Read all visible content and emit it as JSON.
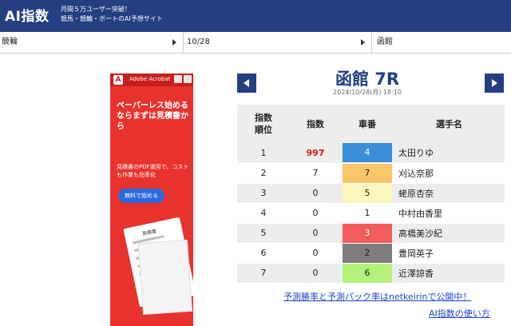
{
  "header": {
    "logo": "AI指数",
    "tagline_1": "月間５万ユーザー突破！",
    "tagline_2": "競馬・競輪・ボートのAI予想サイト"
  },
  "selectors": {
    "sport": "競輪",
    "date": "10/28",
    "venue": "函館"
  },
  "ad": {
    "brand": "Adobe Acrobat",
    "headline": "ペーパーレス始めるならまずは見積書から",
    "body": "見積書のPDF運用で、コストも作業も効率化",
    "button": "無料で始める",
    "doc_title": "見積書"
  },
  "race": {
    "title": "函館 7R",
    "datetime": "2024/10/28(月) 18:10"
  },
  "table": {
    "headers": {
      "rank": "指数順位",
      "score": "指数",
      "bike": "車番",
      "name": "選手名"
    },
    "rows": [
      {
        "rank": "1",
        "score": "997",
        "bike": "4",
        "bike_color": "#3b8fd8",
        "bike_text_color": "#ffffff",
        "name": "太田りゆ"
      },
      {
        "rank": "2",
        "score": "7",
        "bike": "7",
        "bike_color": "#f9c66a",
        "bike_text_color": "#222222",
        "name": "刈込奈那"
      },
      {
        "rank": "3",
        "score": "0",
        "bike": "5",
        "bike_color": "#fbf6bd",
        "bike_text_color": "#222222",
        "name": "蛯原杏奈"
      },
      {
        "rank": "4",
        "score": "0",
        "bike": "1",
        "bike_color": "#ffffff",
        "bike_text_color": "#222222",
        "name": "中村由香里"
      },
      {
        "rank": "5",
        "score": "0",
        "bike": "3",
        "bike_color": "#f25c5c",
        "bike_text_color": "#ffffff",
        "name": "高橋美沙紀"
      },
      {
        "rank": "6",
        "score": "0",
        "bike": "2",
        "bike_color": "#7d7d7d",
        "bike_text_color": "#222222",
        "name": "豊岡英子"
      },
      {
        "rank": "7",
        "score": "0",
        "bike": "6",
        "bike_color": "#b5f27c",
        "bike_text_color": "#222222",
        "name": "近澤諒香"
      }
    ]
  },
  "links": {
    "rates": "予測勝率と予測パック率はnetkeirinで公開中！",
    "howto": "AI指数の使い方"
  },
  "colors": {
    "brand": "#233f82",
    "top_score": "#cc1a1a",
    "link": "#1e45c8"
  }
}
